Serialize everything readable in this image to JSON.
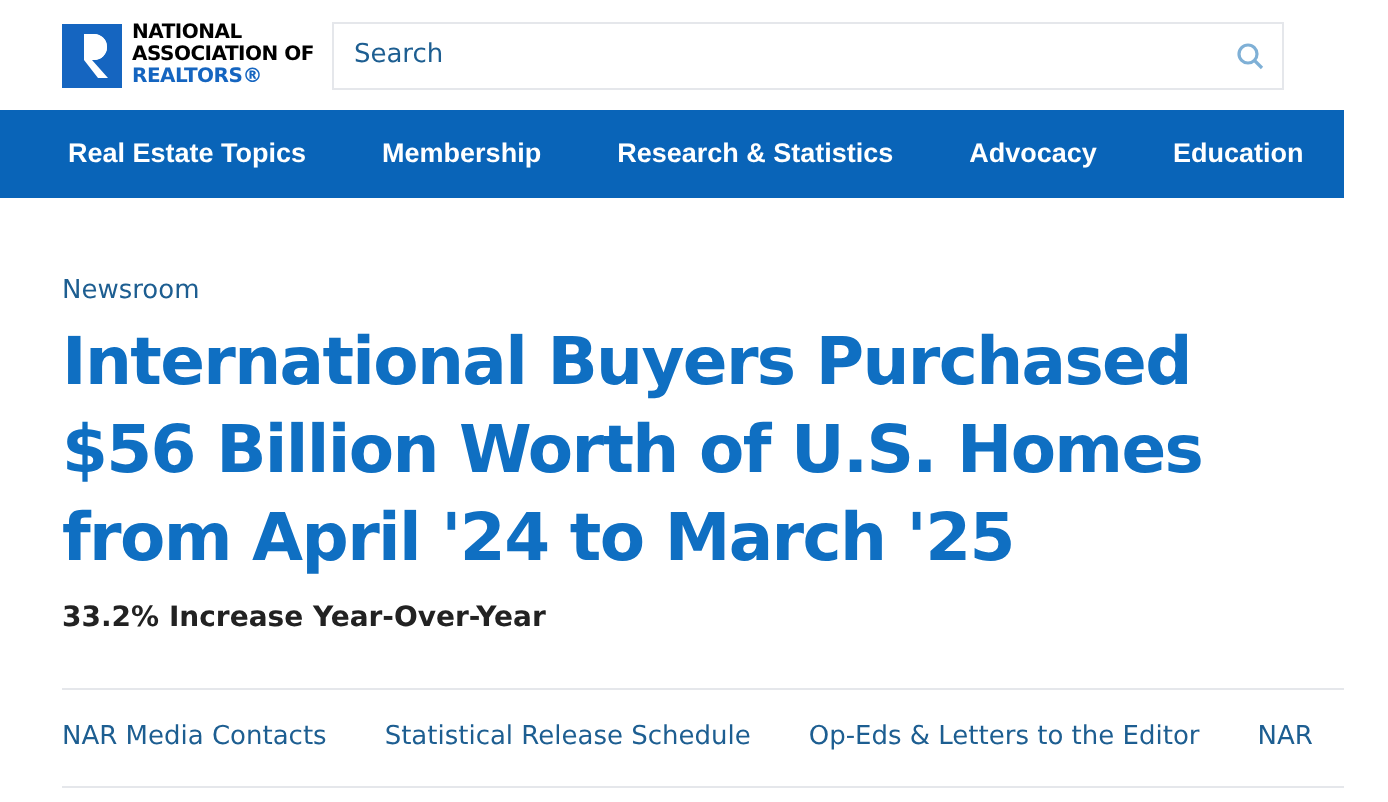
{
  "logo": {
    "lines": [
      "NATIONAL",
      "ASSOCIATION OF",
      "REALTORS®"
    ]
  },
  "search": {
    "placeholder": "Search"
  },
  "nav": [
    {
      "label": "Real Estate Topics"
    },
    {
      "label": "Membership"
    },
    {
      "label": "Research & Statistics"
    },
    {
      "label": "Advocacy"
    },
    {
      "label": "Education"
    }
  ],
  "breadcrumb": "Newsroom",
  "headline": "International Buyers Purchased $56 Billion Worth of U.S. Homes from April '24 to March '25",
  "subhead": "33.2% Increase Year-Over-Year",
  "links": [
    {
      "label": "NAR Media Contacts"
    },
    {
      "label": "Statistical Release Schedule"
    },
    {
      "label": "Op-Eds & Letters to the Editor"
    },
    {
      "label": "NAR"
    }
  ]
}
